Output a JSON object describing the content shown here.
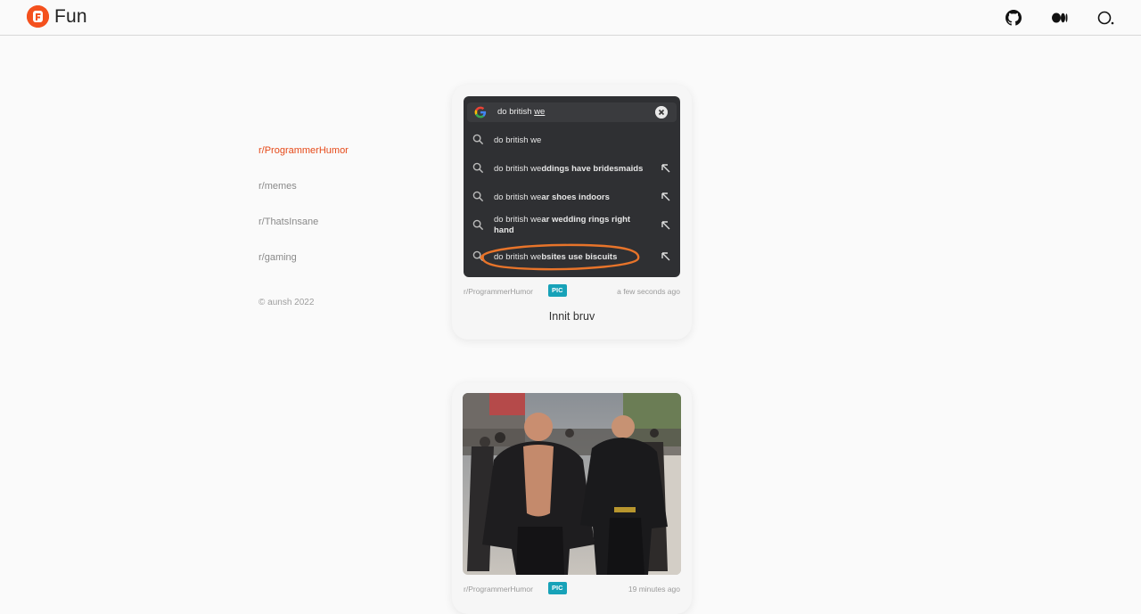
{
  "header": {
    "brand_letter": "F",
    "brand_name": "Fun",
    "icons": [
      "github-icon",
      "medium-icon",
      "profile-icon"
    ]
  },
  "sidebar": {
    "items": [
      {
        "label": "r/ProgrammerHumor",
        "active": true
      },
      {
        "label": "r/memes",
        "active": false
      },
      {
        "label": "r/ThatsInsane",
        "active": false
      },
      {
        "label": "r/gaming",
        "active": false
      }
    ],
    "copyright": "© aunsh 2022"
  },
  "posts": [
    {
      "subreddit": "r/ProgrammerHumor",
      "badge": "PIC",
      "time": "a few seconds ago",
      "caption": "Innit bruv",
      "screenshot": {
        "query_prefix": "do british ",
        "query_underlined": "we",
        "suggestions": [
          {
            "normal": "do british we",
            "bold": ""
          },
          {
            "normal": "do british we",
            "bold": "ddings have bridesmaids"
          },
          {
            "normal": "do british we",
            "bold": "ar shoes indoors"
          },
          {
            "normal": "do british we",
            "bold": "ar wedding rings right hand"
          },
          {
            "normal": "do british we",
            "bold": "bsites use biscuits"
          }
        ]
      }
    },
    {
      "subreddit": "r/ProgrammerHumor",
      "badge": "PIC",
      "time": "19 minutes ago"
    }
  ],
  "colors": {
    "accent": "#e64a19",
    "badge": "#17a2b8",
    "circle": "#e8742a"
  }
}
